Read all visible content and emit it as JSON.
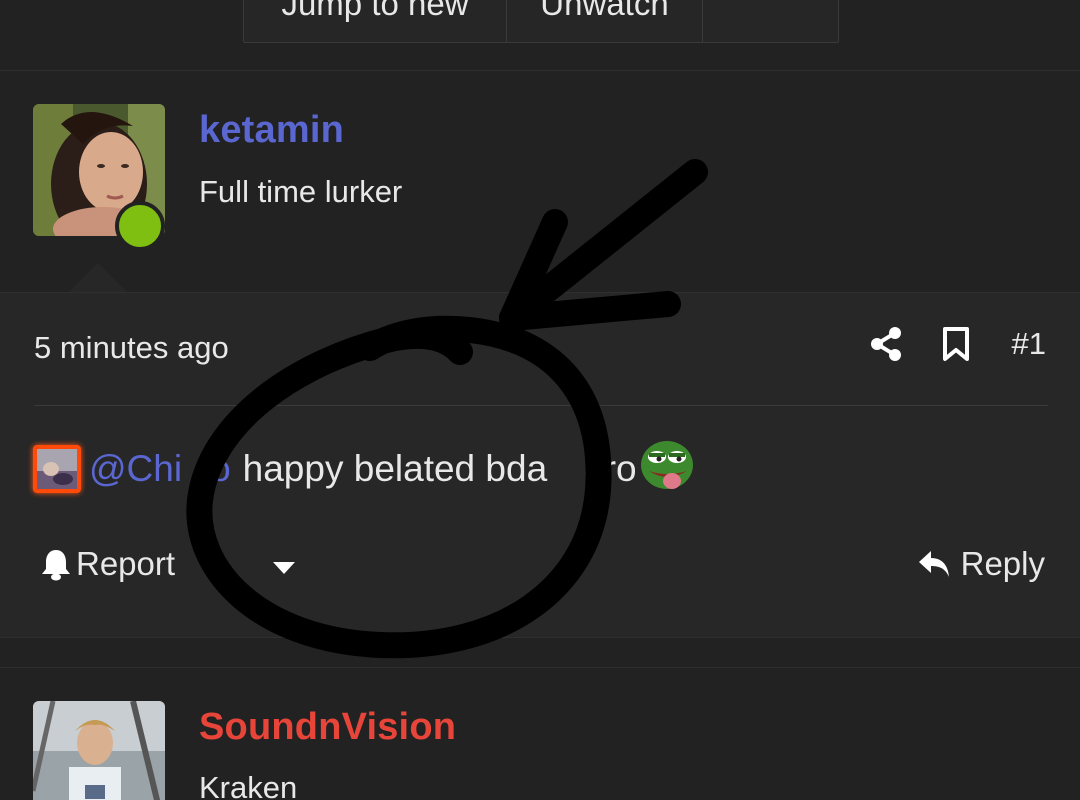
{
  "top_bar": {
    "buttons": [
      "Jump to new",
      "Unwatch",
      ""
    ]
  },
  "post1": {
    "username": "ketamin",
    "user_title": "Full time lurker",
    "online": true,
    "time": "5 minutes ago",
    "post_number": "#1",
    "mention": "@Chi",
    "mention_tail": "o",
    "message": "happy belated bda",
    "message_tail": "bro",
    "emoji": "pepe-emoji",
    "report_label": "Report",
    "reply_label": "Reply"
  },
  "post2": {
    "username": "SoundnVision",
    "user_title": "Kraken"
  },
  "colors": {
    "background": "#222222",
    "post_body": "#272727",
    "username_blue": "#5b67d0",
    "username_red": "#e8453a",
    "online_green": "#7fbf12",
    "mention_border": "#ff4a0a"
  }
}
